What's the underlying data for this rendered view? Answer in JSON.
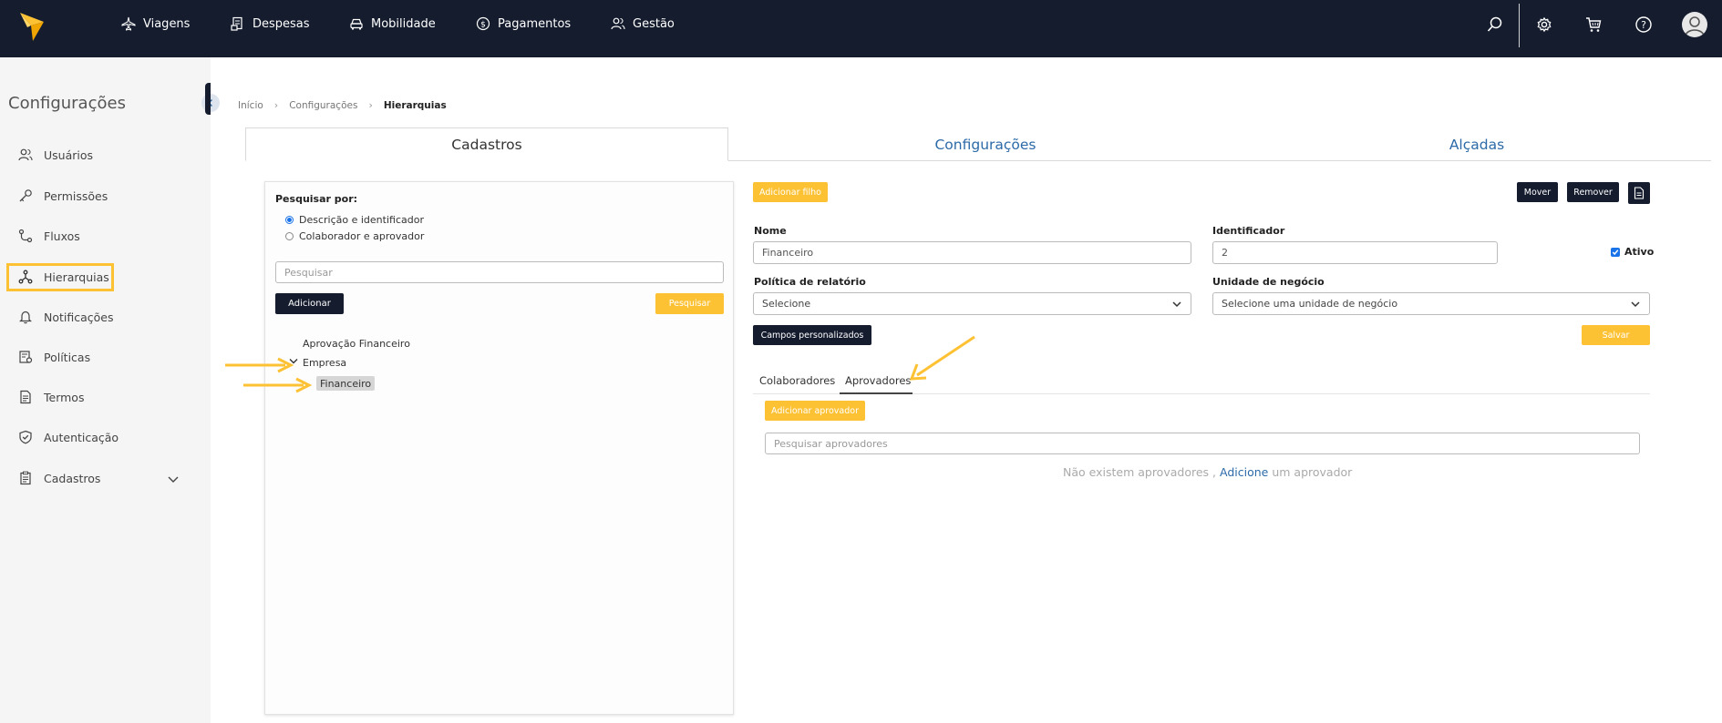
{
  "topnav": {
    "items": [
      {
        "label": "Viagens",
        "icon": "airplane-icon"
      },
      {
        "label": "Despesas",
        "icon": "receipt-icon"
      },
      {
        "label": "Mobilidade",
        "icon": "car-icon"
      },
      {
        "label": "Pagamentos",
        "icon": "dollar-icon"
      },
      {
        "label": "Gestão",
        "icon": "users-icon"
      }
    ],
    "right_icons": [
      "search-icon",
      "gear-icon",
      "cart-icon",
      "help-icon",
      "avatar-icon"
    ]
  },
  "sidebar": {
    "title": "Configurações",
    "items": [
      {
        "label": "Usuários",
        "icon": "users-icon"
      },
      {
        "label": "Permissões",
        "icon": "key-icon"
      },
      {
        "label": "Fluxos",
        "icon": "flow-icon"
      },
      {
        "label": "Hierarquias",
        "icon": "hierarchy-icon",
        "active": true
      },
      {
        "label": "Notificações",
        "icon": "bell-icon"
      },
      {
        "label": "Políticas",
        "icon": "policy-icon"
      },
      {
        "label": "Termos",
        "icon": "document-icon"
      },
      {
        "label": "Autenticação",
        "icon": "shield-icon"
      },
      {
        "label": "Cadastros",
        "icon": "clipboard-icon",
        "expandable": true
      }
    ]
  },
  "breadcrumb": {
    "items": [
      "Início",
      "Configurações"
    ],
    "current": "Hierarquias"
  },
  "main_tabs": [
    {
      "label": "Cadastros",
      "active": true
    },
    {
      "label": "Configurações"
    },
    {
      "label": "Alçadas"
    }
  ],
  "search_panel": {
    "search_by_label": "Pesquisar por:",
    "options": [
      {
        "label": "Descrição e identificador",
        "selected": true
      },
      {
        "label": "Colaborador e aprovador",
        "selected": false
      }
    ],
    "search_placeholder": "Pesquisar",
    "add_label": "Adicionar",
    "search_button": "Pesquisar"
  },
  "tree": {
    "items": [
      {
        "label": "Aprovação Financeiro"
      },
      {
        "label": "Empresa",
        "expanded": true
      },
      {
        "label": "Financeiro",
        "selected": true
      }
    ]
  },
  "form": {
    "add_child_label": "Adicionar filho",
    "move_label": "Mover",
    "remove_label": "Remover",
    "name_label": "Nome",
    "name_value": "Financeiro",
    "identifier_label": "Identificador",
    "identifier_value": "2",
    "active_label": "Ativo",
    "active_checked": true,
    "policy_label": "Política de relatório",
    "policy_value": "Selecione",
    "business_unit_label": "Unidade de negócio",
    "business_unit_value": "Selecione uma unidade de negócio",
    "custom_fields_label": "Campos personalizados",
    "save_label": "Salvar"
  },
  "sub_tabs": [
    {
      "label": "Colaboradores"
    },
    {
      "label": "Aprovadores",
      "active": true
    }
  ],
  "approvers": {
    "add_label": "Adicionar aprovador",
    "search_placeholder": "Pesquisar aprovadores",
    "empty_text": "Não existem aprovadores ,",
    "empty_link": "Adicione",
    "empty_suffix": "um aprovador"
  },
  "colors": {
    "topbar": "#141c2e",
    "accent_yellow": "#fdc134",
    "link_blue": "#2c6aa8",
    "checkbox_blue": "#1a73e8"
  }
}
